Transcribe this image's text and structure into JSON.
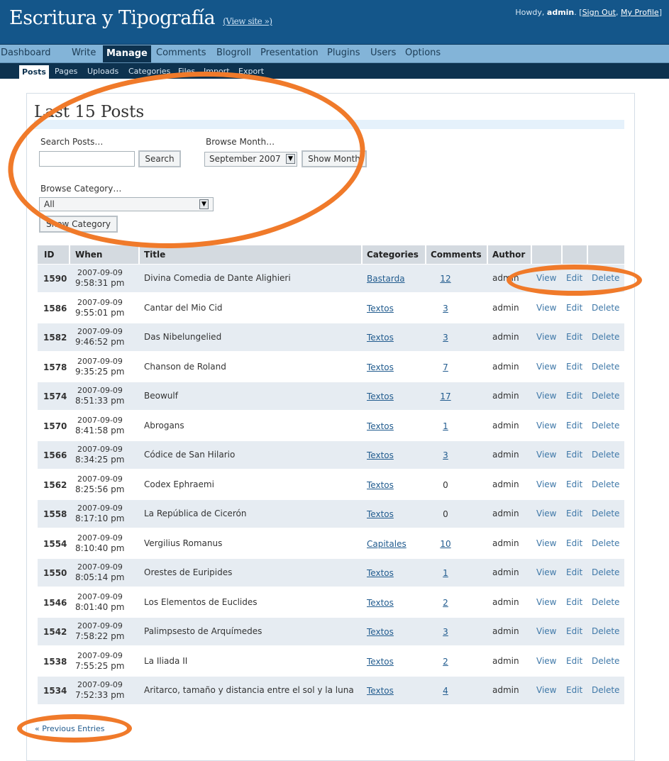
{
  "header": {
    "site_title": "Escritura y Tipografía",
    "view_site": "(View site »)",
    "howdy": "Howdy,",
    "username": "admin",
    "sign_out": "Sign Out",
    "my_profile": "My Profile"
  },
  "menu": [
    "Dashboard",
    "Write",
    "Manage",
    "Comments",
    "Blogroll",
    "Presentation",
    "Plugins",
    "Users",
    "Options"
  ],
  "menu_active": "Manage",
  "submenu": [
    "Posts",
    "Pages",
    "Uploads",
    "Categories",
    "Files",
    "Import",
    "Export"
  ],
  "submenu_active": "Posts",
  "page_title": "Last 15 Posts",
  "search": {
    "label": "Search Posts…",
    "value": "",
    "button": "Search"
  },
  "browse_month": {
    "label": "Browse Month…",
    "selected": "September 2007",
    "button": "Show Month"
  },
  "browse_category": {
    "label": "Browse Category…",
    "selected": "All",
    "button": "Show Category"
  },
  "table": {
    "headers": [
      "ID",
      "When",
      "Title",
      "Categories",
      "Comments",
      "Author"
    ],
    "actions": {
      "view": "View",
      "edit": "Edit",
      "delete": "Delete"
    },
    "rows": [
      {
        "id": "1590",
        "date": "2007-09-09",
        "time": "9:58:31 pm",
        "title": "Divina Comedia de Dante Alighieri",
        "category": "Bastarda",
        "comments": "12",
        "author": "admin"
      },
      {
        "id": "1586",
        "date": "2007-09-09",
        "time": "9:55:01 pm",
        "title": "Cantar del Mio Cid",
        "category": "Textos",
        "comments": "3",
        "author": "admin"
      },
      {
        "id": "1582",
        "date": "2007-09-09",
        "time": "9:46:52 pm",
        "title": "Das Nibelungelied",
        "category": "Textos",
        "comments": "3",
        "author": "admin"
      },
      {
        "id": "1578",
        "date": "2007-09-09",
        "time": "9:35:25 pm",
        "title": "Chanson de Roland",
        "category": "Textos",
        "comments": "7",
        "author": "admin"
      },
      {
        "id": "1574",
        "date": "2007-09-09",
        "time": "8:51:33 pm",
        "title": "Beowulf",
        "category": "Textos",
        "comments": "17",
        "author": "admin"
      },
      {
        "id": "1570",
        "date": "2007-09-09",
        "time": "8:41:58 pm",
        "title": "Abrogans",
        "category": "Textos",
        "comments": "1",
        "author": "admin"
      },
      {
        "id": "1566",
        "date": "2007-09-09",
        "time": "8:34:25 pm",
        "title": "Códice de San Hilario",
        "category": "Textos",
        "comments": "3",
        "author": "admin"
      },
      {
        "id": "1562",
        "date": "2007-09-09",
        "time": "8:25:56 pm",
        "title": "Codex Ephraemi",
        "category": "Textos",
        "comments": "0",
        "author": "admin"
      },
      {
        "id": "1558",
        "date": "2007-09-09",
        "time": "8:17:10 pm",
        "title": "La República de Cicerón",
        "category": "Textos",
        "comments": "0",
        "author": "admin"
      },
      {
        "id": "1554",
        "date": "2007-09-09",
        "time": "8:10:40 pm",
        "title": "Vergilius Romanus",
        "category": "Capitales",
        "comments": "10",
        "author": "admin"
      },
      {
        "id": "1550",
        "date": "2007-09-09",
        "time": "8:05:14 pm",
        "title": "Orestes de Euripides",
        "category": "Textos",
        "comments": "1",
        "author": "admin"
      },
      {
        "id": "1546",
        "date": "2007-09-09",
        "time": "8:01:40 pm",
        "title": "Los Elementos de Euclides",
        "category": "Textos",
        "comments": "2",
        "author": "admin"
      },
      {
        "id": "1542",
        "date": "2007-09-09",
        "time": "7:58:22 pm",
        "title": "Palimpsesto de Arquímedes",
        "category": "Textos",
        "comments": "3",
        "author": "admin"
      },
      {
        "id": "1538",
        "date": "2007-09-09",
        "time": "7:55:25 pm",
        "title": "La Iliada II",
        "category": "Textos",
        "comments": "2",
        "author": "admin"
      },
      {
        "id": "1534",
        "date": "2007-09-09",
        "time": "7:52:33 pm",
        "title": "Aritarco, tamaño y distancia entre el sol y la luna",
        "category": "Textos",
        "comments": "4",
        "author": "admin"
      }
    ]
  },
  "previous_entries": "« Previous Entries",
  "colors": {
    "header_bg": "#14568a",
    "menu_bg": "#83b4d8",
    "submenu_bg": "#0d324f",
    "annotation": "#f07a2a",
    "link": "#225c8f"
  }
}
